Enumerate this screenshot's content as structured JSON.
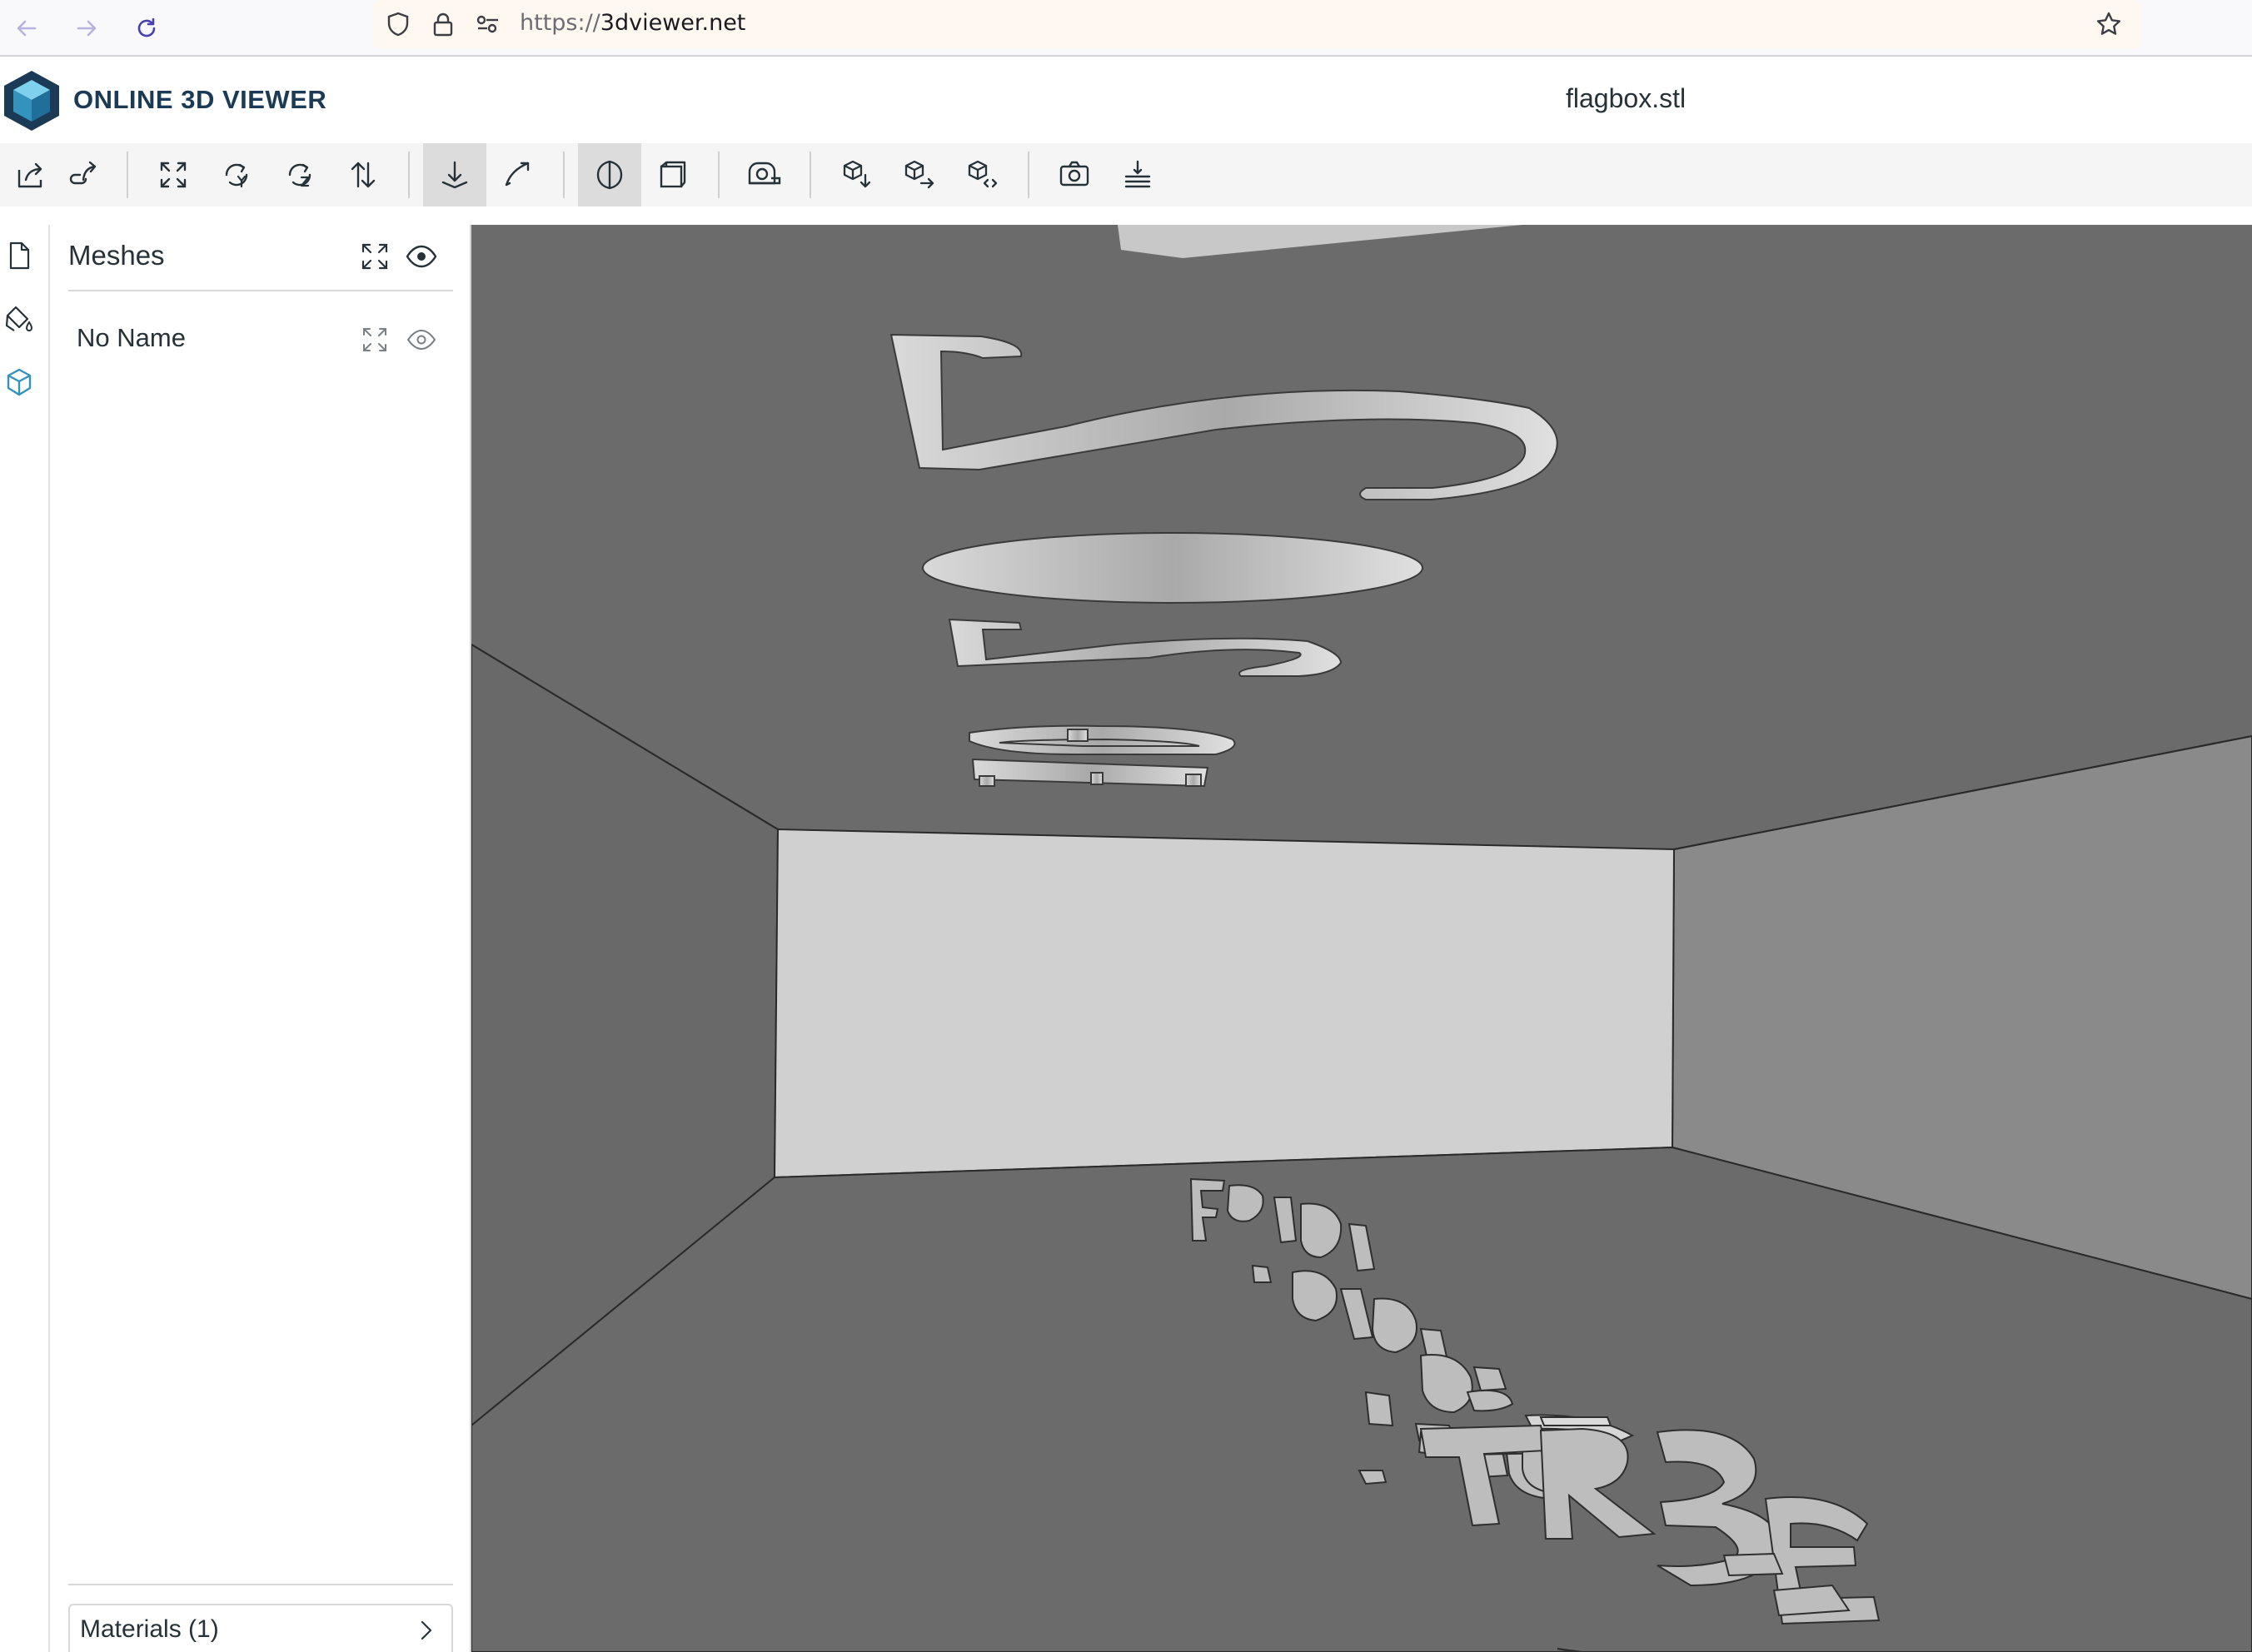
{
  "browser": {
    "url_scheme": "https://",
    "url_host": "3dviewer.net"
  },
  "app": {
    "title": "ONLINE 3D VIEWER",
    "file_name": "flagbox.stl",
    "brand_color": "#1b3a56",
    "accent_color": "#3393bd"
  },
  "toolbar": {
    "buttons": [
      {
        "icon": "open-file-icon"
      },
      {
        "icon": "open-url-icon"
      },
      {
        "icon": "fit-to-window-icon"
      },
      {
        "icon": "set-up-vector-y-icon"
      },
      {
        "icon": "set-up-vector-z-icon"
      },
      {
        "icon": "flip-up-vector-icon"
      },
      {
        "icon": "fixed-up-vector-icon",
        "active": true
      },
      {
        "icon": "free-orbit-icon"
      },
      {
        "icon": "perspective-camera-icon",
        "active": true
      },
      {
        "icon": "orthographic-camera-icon"
      },
      {
        "icon": "measure-icon"
      },
      {
        "icon": "download-model-icon"
      },
      {
        "icon": "export-model-icon"
      },
      {
        "icon": "share-model-icon"
      },
      {
        "icon": "snapshot-icon"
      },
      {
        "icon": "settings-icon"
      }
    ]
  },
  "left_nav": [
    "file-details-icon",
    "materials-icon",
    "meshes-icon"
  ],
  "panel": {
    "heading": "Meshes",
    "meshes": [
      {
        "name": "No Name"
      }
    ],
    "materials_label": "Materials (1)"
  },
  "viewer": {
    "background": "#6b6b6b",
    "model": "flagbox.stl"
  }
}
